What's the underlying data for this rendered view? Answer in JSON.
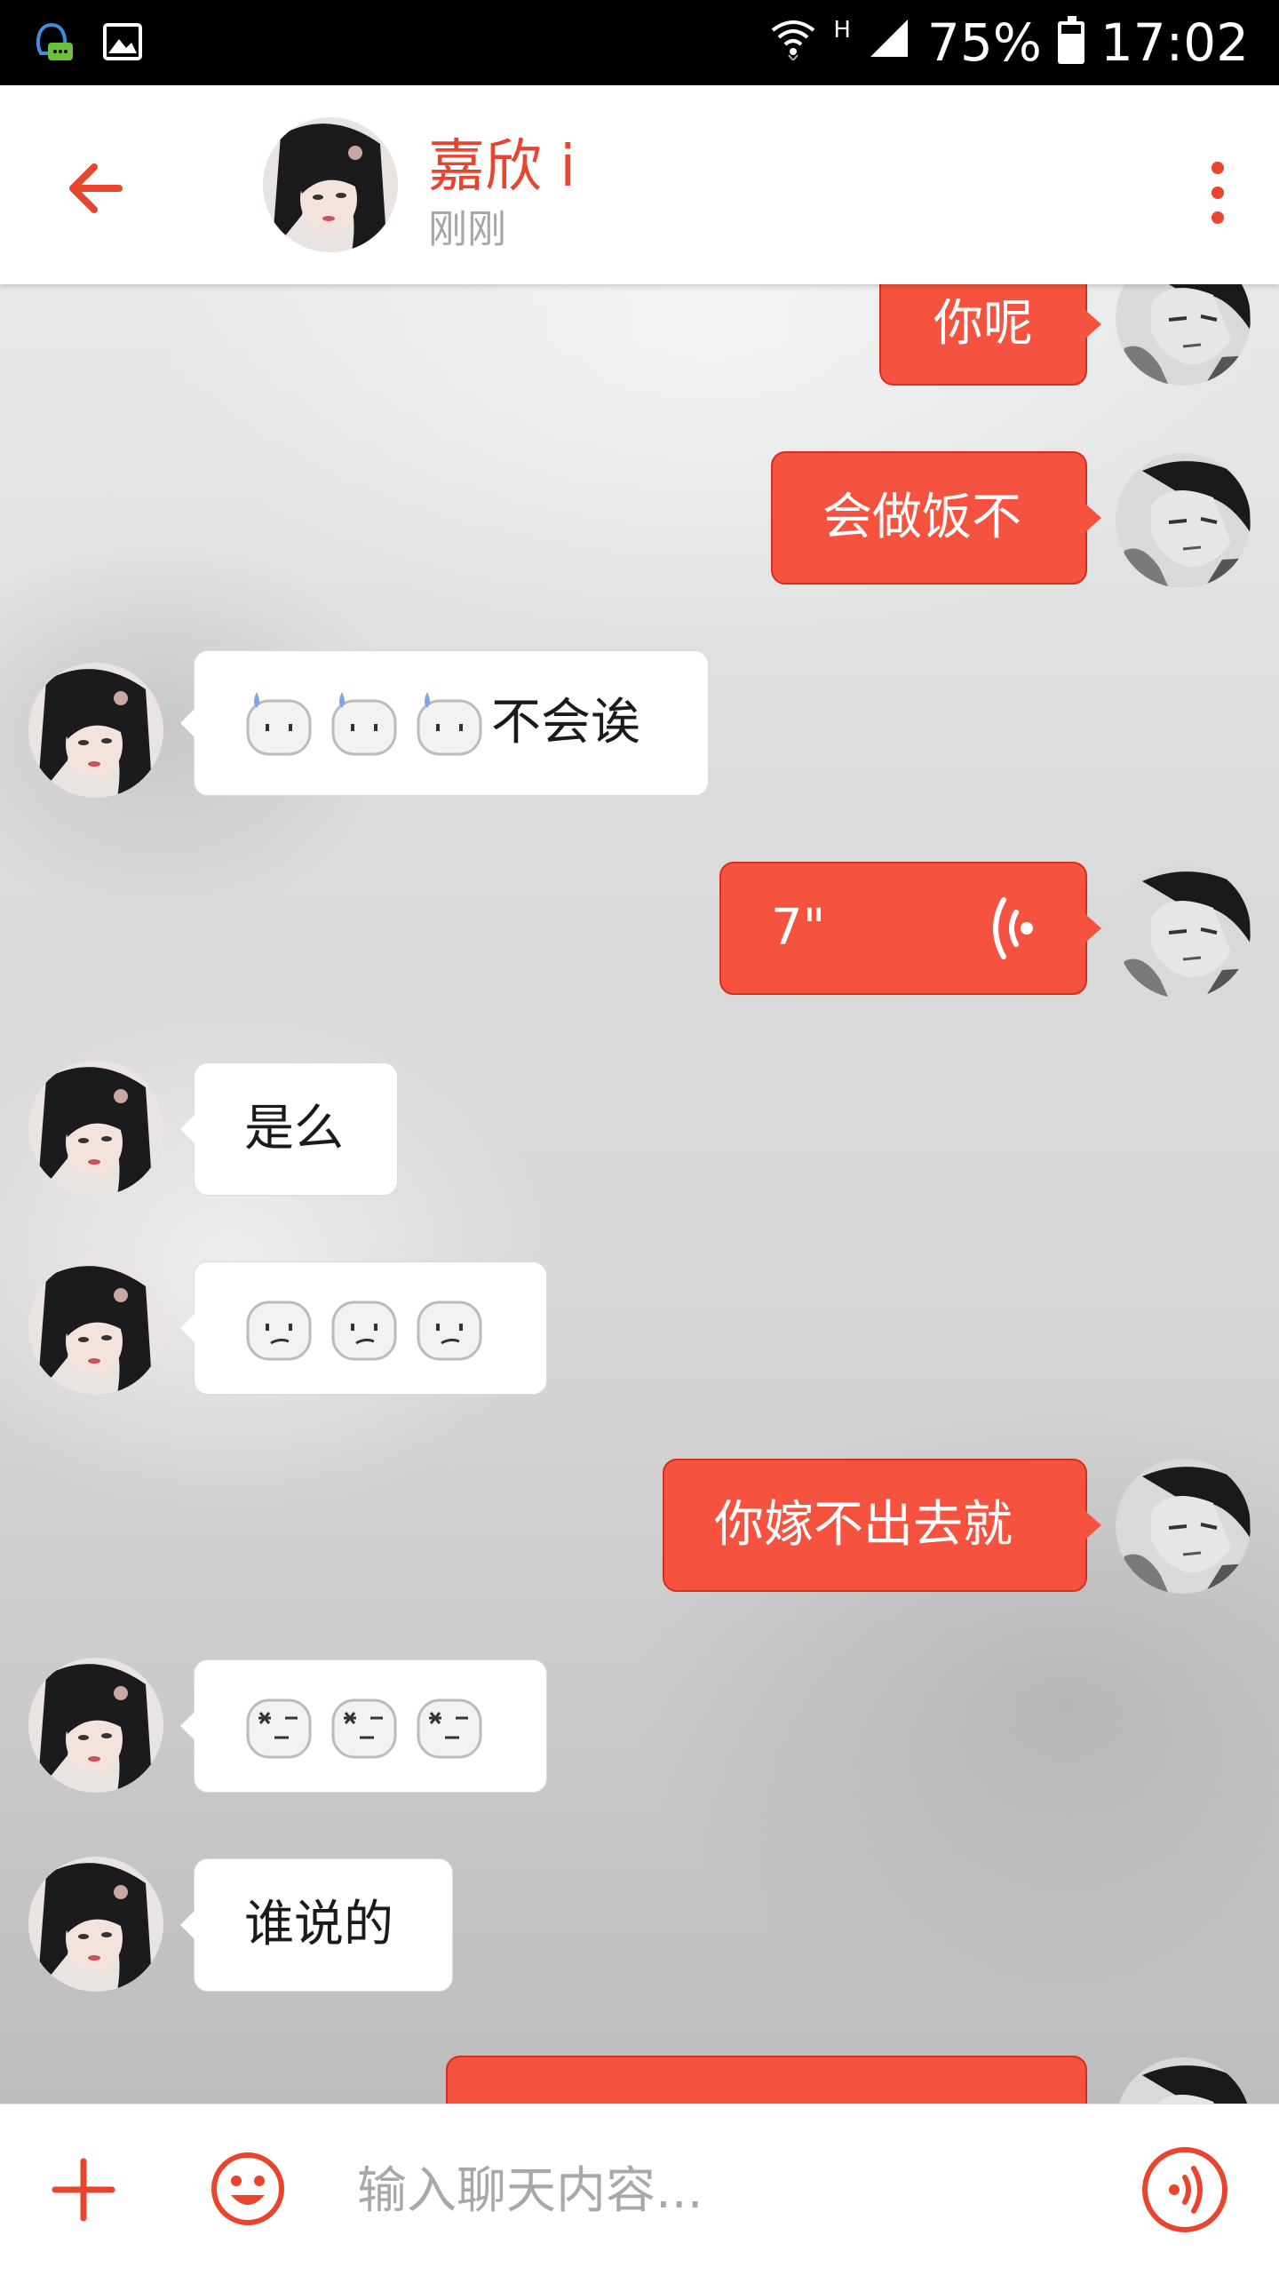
{
  "status_bar": {
    "network": "H",
    "battery": "75%",
    "battery_level": 0.75,
    "time": "17:02",
    "icons": [
      "qq-notification-icon",
      "image-notification-icon",
      "wifi-icon",
      "cell-signal-icon",
      "battery-icon"
    ]
  },
  "header": {
    "contact_name": "嘉欣 i",
    "status": "刚刚",
    "icons": [
      "back-arrow-icon",
      "more-vertical-icon"
    ],
    "accent_color": "#e8442e"
  },
  "messages": [
    {
      "side": "out",
      "type": "text",
      "text": "你呢"
    },
    {
      "side": "out",
      "type": "text",
      "text": "会做饭不"
    },
    {
      "side": "in",
      "type": "emoji_text",
      "emojis": [
        "sweat-emoji",
        "sweat-emoji",
        "sweat-emoji"
      ],
      "text": "不会诶"
    },
    {
      "side": "out",
      "type": "voice",
      "duration": "7\""
    },
    {
      "side": "in",
      "type": "text",
      "text": "是么"
    },
    {
      "side": "in",
      "type": "emoji",
      "emojis": [
        "confused-emoji",
        "confused-emoji",
        "confused-emoji"
      ]
    },
    {
      "side": "out",
      "type": "text",
      "text": "你嫁不出去就"
    },
    {
      "side": "in",
      "type": "emoji",
      "emojis": [
        "dizzy-emoji",
        "dizzy-emoji",
        "dizzy-emoji"
      ]
    },
    {
      "side": "in",
      "type": "text",
      "text": "谁说的"
    },
    {
      "side": "out",
      "type": "text",
      "text": ""
    }
  ],
  "input_bar": {
    "placeholder": "输入聊天内容...",
    "value": "",
    "icons": [
      "plus-icon",
      "smiley-icon",
      "voice-icon"
    ]
  },
  "colors": {
    "accent": "#e8442e",
    "outgoing_bubble": "#f5533f",
    "incoming_bubble": "#ffffff"
  }
}
